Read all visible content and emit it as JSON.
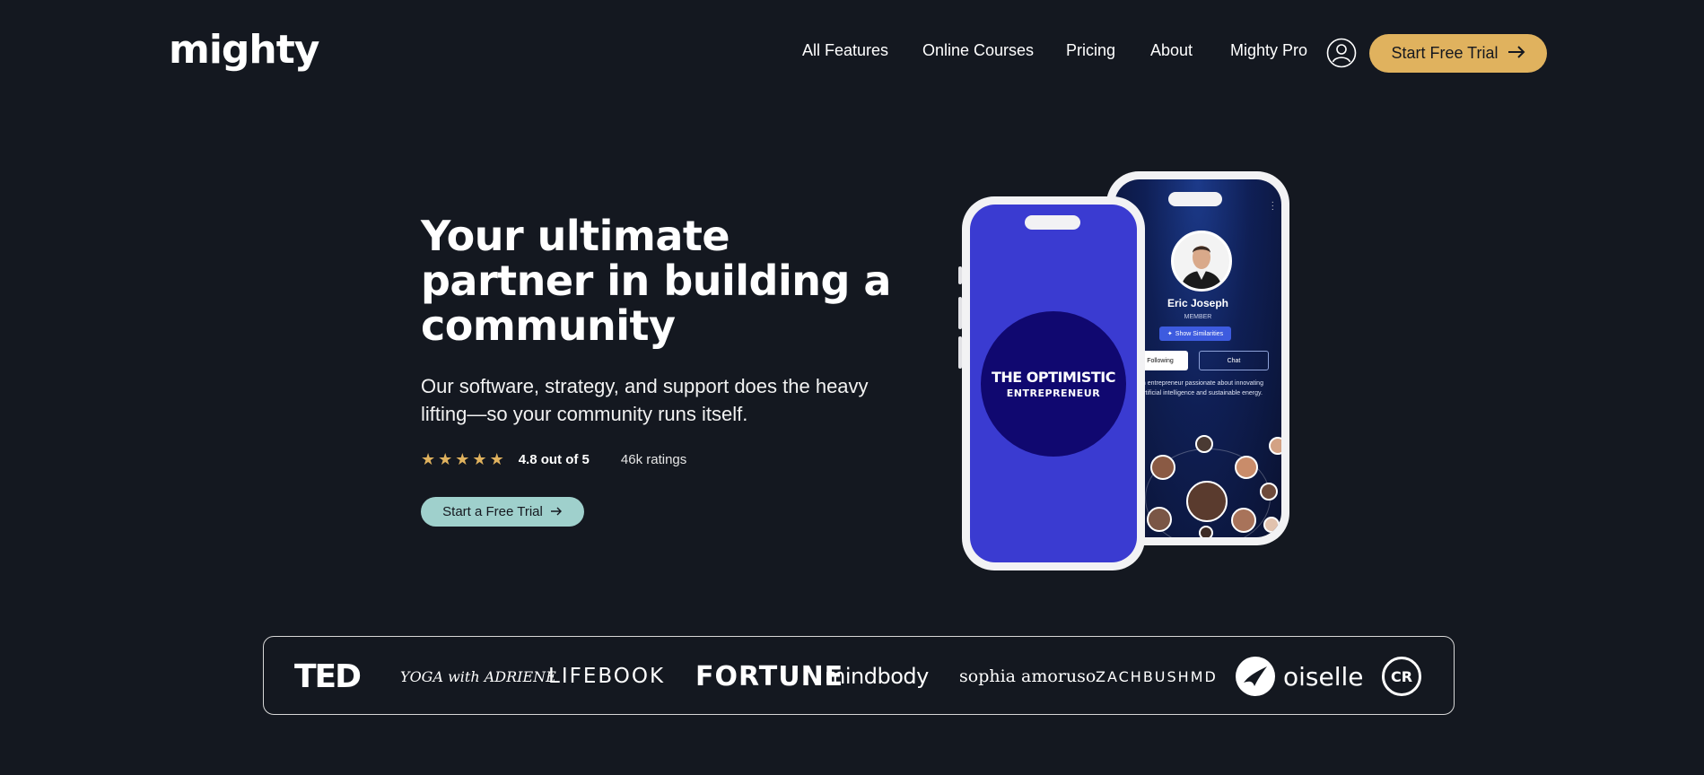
{
  "header": {
    "logo": "mighty",
    "nav": [
      {
        "label": "All Features"
      },
      {
        "label": "Online Courses"
      },
      {
        "label": "Pricing"
      },
      {
        "label": "About"
      },
      {
        "label": "Mighty Pro"
      }
    ],
    "user_icon": "user-circle-icon",
    "cta_label": "Start Free Trial",
    "cta_icon": "arrow-right-icon",
    "cta_color": "#e0b25e"
  },
  "hero": {
    "title": "Your ultimate partner in building a community",
    "subtitle": "Our software, strategy, and support does the heavy lifting—so your community runs itself.",
    "rating": {
      "stars": 5,
      "score_label": "4.8 out of 5",
      "count_label": "46k ratings",
      "star_color": "#e0b25e"
    },
    "cta_label": "Start a Free Trial",
    "cta_color": "#9fd0cc"
  },
  "phone_front": {
    "podcast_title": "THE OPTIMISTIC",
    "podcast_subtitle": "ENTREPRENEUR",
    "screen_color": "#3a3bd1"
  },
  "phone_back": {
    "name": "Eric Joseph",
    "role": "MEMBER",
    "similarities_label": "Show Similarities",
    "following_label": "Following",
    "chat_label": "Chat",
    "bio": "Tech entrepreneur passionate about innovating in artificial intelligence and sustainable energy."
  },
  "brands": [
    "TED",
    "YOGA with ADRIENE",
    "LIFEBOOK",
    "FORTUNE",
    "mindbody",
    "sophia amoruso",
    "ZACHBUSHMD",
    "oiselle",
    "CR"
  ],
  "colors": {
    "background": "#141820",
    "text": "#ffffff"
  }
}
